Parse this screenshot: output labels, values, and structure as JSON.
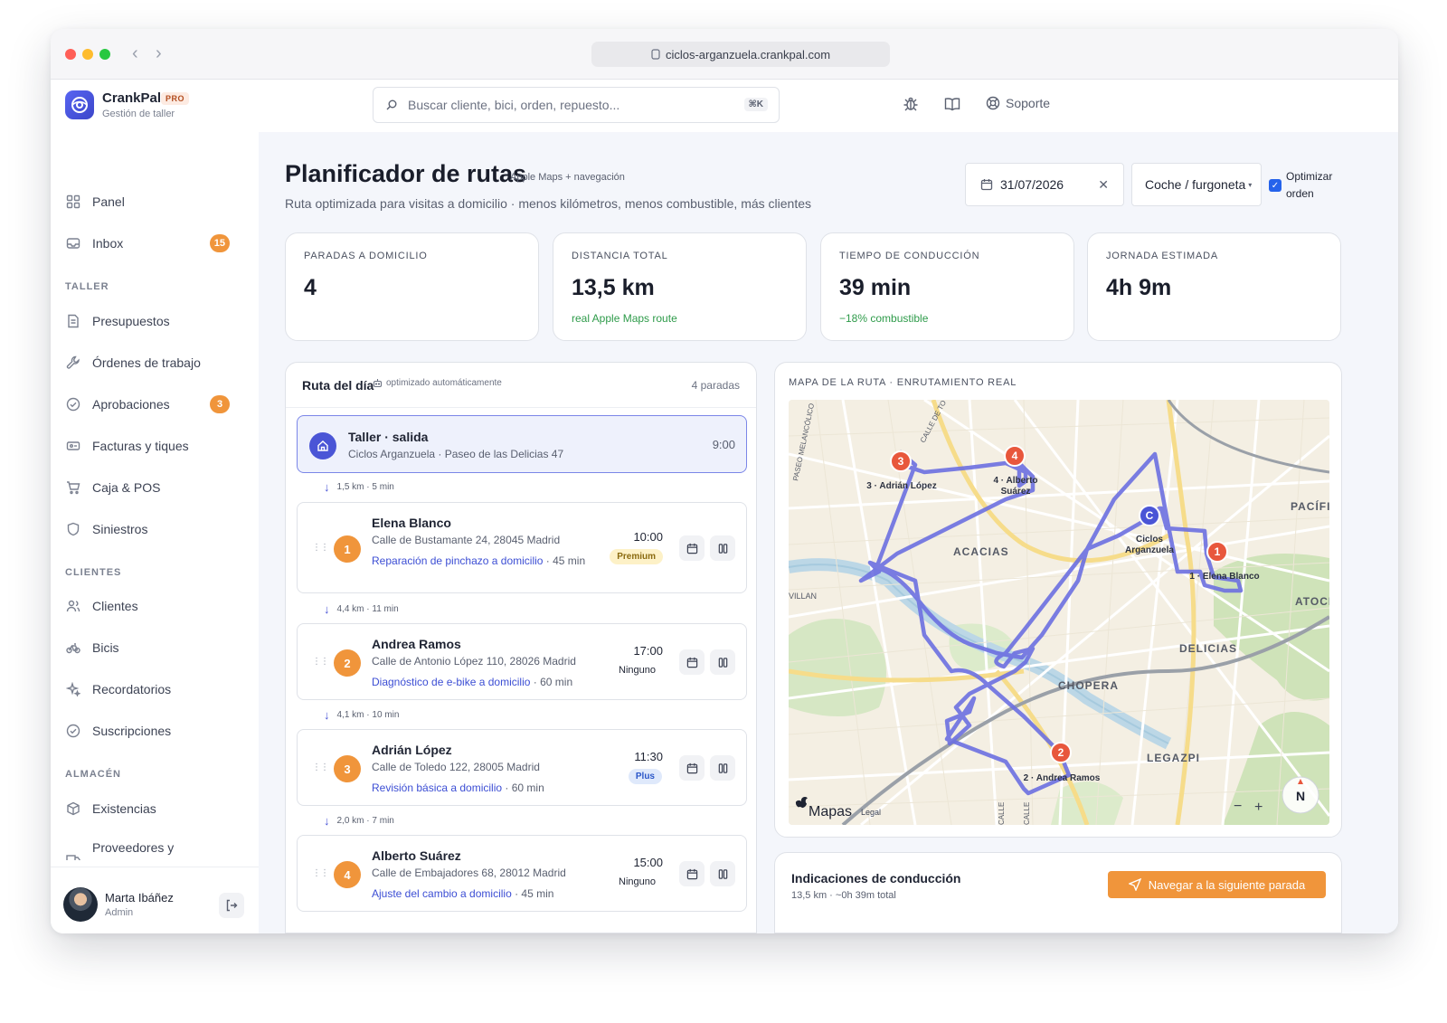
{
  "browser": {
    "url": "ciclos-arganzuela.crankpal.com"
  },
  "brand": {
    "name": "CrankPal",
    "badge": "PRO",
    "subtitle": "Gestión de taller"
  },
  "search": {
    "placeholder": "Buscar cliente, bici, orden, repuesto...",
    "shortcut": "⌘K"
  },
  "topbar": {
    "support_label": "Soporte"
  },
  "sidebar": {
    "top_items": [
      {
        "label": "Panel",
        "icon": "grid-icon"
      },
      {
        "label": "Inbox",
        "icon": "inbox-icon",
        "badge": "15"
      }
    ],
    "sections": [
      {
        "title": "TALLER",
        "items": [
          {
            "label": "Presupuestos",
            "icon": "document-icon"
          },
          {
            "label": "Órdenes de trabajo",
            "icon": "wrench-icon"
          },
          {
            "label": "Aprobaciones",
            "icon": "check-circle-icon",
            "badge": "3"
          },
          {
            "label": "Facturas y tiques",
            "icon": "receipt-icon"
          },
          {
            "label": "Caja & POS",
            "icon": "cart-icon"
          },
          {
            "label": "Siniestros",
            "icon": "shield-icon"
          }
        ]
      },
      {
        "title": "CLIENTES",
        "items": [
          {
            "label": "Clientes",
            "icon": "users-icon"
          },
          {
            "label": "Bicis",
            "icon": "bike-icon"
          },
          {
            "label": "Recordatorios",
            "icon": "sparkle-icon"
          },
          {
            "label": "Suscripciones",
            "icon": "check-circle-icon"
          }
        ]
      },
      {
        "title": "ALMACÉN",
        "items": [
          {
            "label": "Existencias",
            "icon": "box-icon"
          },
          {
            "label": "Proveedores y",
            "icon": "truck-icon"
          }
        ]
      }
    ],
    "user": {
      "name": "Marta Ibáñez",
      "role": "Admin"
    }
  },
  "page": {
    "title": "Planificador de rutas",
    "title_badge": "Apple Maps + navegación",
    "subtitle": "Ruta optimizada para visitas a domicilio · menos kilómetros, menos combustible, más clientes",
    "date": "31/07/2026",
    "vehicle": "Coche / furgoneta",
    "optimize_label": "Optimizar orden",
    "optimize_checked": true
  },
  "kpis": [
    {
      "label": "PARADAS A DOMICILIO",
      "value": "4",
      "note": ""
    },
    {
      "label": "DISTANCIA TOTAL",
      "value": "13,5 km",
      "note": "real Apple Maps route"
    },
    {
      "label": "TIEMPO DE CONDUCCIÓN",
      "value": "39 min",
      "note": "−18% combustible"
    },
    {
      "label": "JORNADA ESTIMADA",
      "value": "4h 9m",
      "note": ""
    }
  ],
  "route": {
    "title": "Ruta del día",
    "auto_label": "optimizado automáticamente",
    "count_label": "4 paradas",
    "depot": {
      "title": "Taller · salida",
      "subtitle": "Ciclos Arganzuela · Paseo de las Delicias 47",
      "time": "9:00"
    },
    "legs": [
      "1,5 km · 5 min",
      "4,4 km · 11 min",
      "4,1 km · 10 min",
      "2,0 km · 7 min"
    ],
    "stops": [
      {
        "num": "1",
        "name": "Elena Blanco",
        "address": "Calle de Bustamante 24, 28045 Madrid",
        "service": "Reparación de pinchazo a domicilio",
        "duration": " · 45 min",
        "time": "10:00",
        "plan": "Premium"
      },
      {
        "num": "2",
        "name": "Andrea Ramos",
        "address": "Calle de Antonio López 110, 28026 Madrid",
        "service": "Diagnóstico de e-bike a domicilio",
        "duration": " · 60 min",
        "time": "17:00",
        "plan": "Ninguno"
      },
      {
        "num": "3",
        "name": "Adrián López",
        "address": "Calle de Toledo 122, 28005 Madrid",
        "service": "Revisión básica a domicilio",
        "duration": " · 60 min",
        "time": "11:30",
        "plan": "Plus"
      },
      {
        "num": "4",
        "name": "Alberto Suárez",
        "address": "Calle de Embajadores 68, 28012 Madrid",
        "service": "Ajuste del cambio a domicilio",
        "duration": " · 45 min",
        "time": "15:00",
        "plan": "Ninguno"
      }
    ]
  },
  "map": {
    "title": "MAPA DE LA RUTA · ENRUTAMIENTO REAL",
    "districts": [
      "ACACIAS",
      "DELICIAS",
      "CHOPERA",
      "LEGAZPI",
      "PACÍFIC",
      "ATOCH"
    ],
    "streets": [
      "PASEO MELANCÓLICO",
      "CALLE DE TO",
      "CALLE",
      "CALLE"
    ],
    "edge_label": "VILLAN",
    "depot_marker": "C",
    "depot_label_1": "Ciclos",
    "depot_label_2": "Arganzuela",
    "markers": [
      {
        "num": "1",
        "label": "1 · Elena Blanco"
      },
      {
        "num": "2",
        "label": "2 · Andrea Ramos"
      },
      {
        "num": "3",
        "label": "3 · Adrián López"
      },
      {
        "num": "4",
        "label_1": "4 · Alberto",
        "label_2": "Suárez"
      }
    ],
    "logo_text": "Mapas",
    "legal_text": "Legal",
    "zoom_minus": "−",
    "zoom_plus": "+",
    "compass": "N"
  },
  "directions": {
    "title": "Indicaciones de conducción",
    "summary": "13,5 km · ~0h 39m total",
    "button_label": "Navegar a la siguiente parada"
  },
  "colors": {
    "accent": "#4a55d6",
    "orange": "#f0953b",
    "route": "#6b6fe0",
    "green": "#2e9b4a"
  }
}
